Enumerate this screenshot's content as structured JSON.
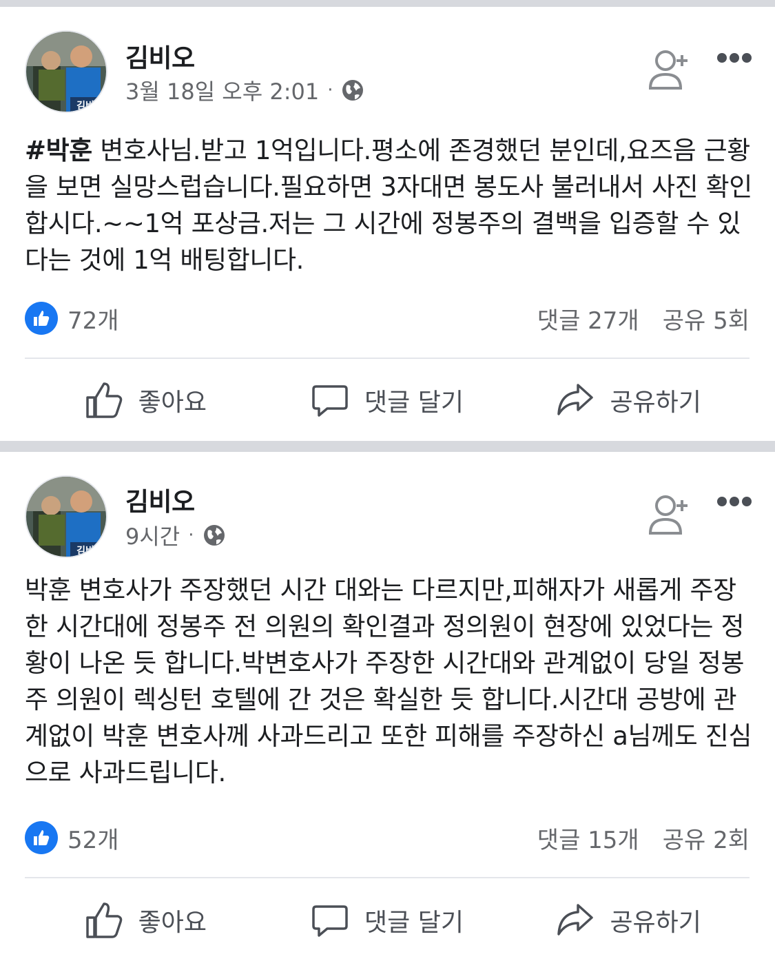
{
  "posts": [
    {
      "author": "김비오",
      "time": "3월 18일 오후 2:01",
      "meta_sep": "·",
      "avatar_caption": "김비",
      "hashtag": "#박훈",
      "text": " 변호사님.받고 1억입니다.평소에 존경했던 분인데,요즈음 근황을 보면 실망스럽습니다.필요하면 3자대면 봉도사 불러내서 사진 확인합시다.~~1억 포상금.저는 그 시간에 정봉주의 결백을 입증할 수 있다는 것에 1억 배팅합니다.",
      "likes": "72개",
      "comments": "댓글 27개",
      "shares": "공유 5회"
    },
    {
      "author": "김비오",
      "time": "9시간",
      "meta_sep": "·",
      "avatar_caption": "김비",
      "hashtag": "",
      "text": "박훈 변호사가 주장했던 시간 대와는 다르지만,피해자가 새롭게 주장한 시간대에 정봉주 전 의원의 확인결과 정의원이 현장에 있었다는 정황이 나온 듯 합니다.박변호사가 주장한 시간대와 관계없이 당일 정봉주 의원이 렉싱턴 호텔에 간 것은 확실한 듯 합니다.시간대 공방에 관계없이 박훈 변호사께 사과드리고 또한 피해를 주장하신 a님께도 진심으로 사과드립니다.",
      "likes": "52개",
      "comments": "댓글 15개",
      "shares": "공유 2회"
    }
  ],
  "actions": {
    "like": "좋아요",
    "comment": "댓글 달기",
    "share": "공유하기"
  },
  "icons": {
    "like": "thumbs-up-icon",
    "comment": "speech-bubble-icon",
    "share": "share-arrow-icon",
    "privacy": "globe-icon",
    "add_friend": "add-friend-icon",
    "more": "more-options-icon"
  },
  "colors": {
    "like_blue": "#1877f2",
    "secondary_text": "#65676b",
    "separator": "#d7d9de"
  }
}
